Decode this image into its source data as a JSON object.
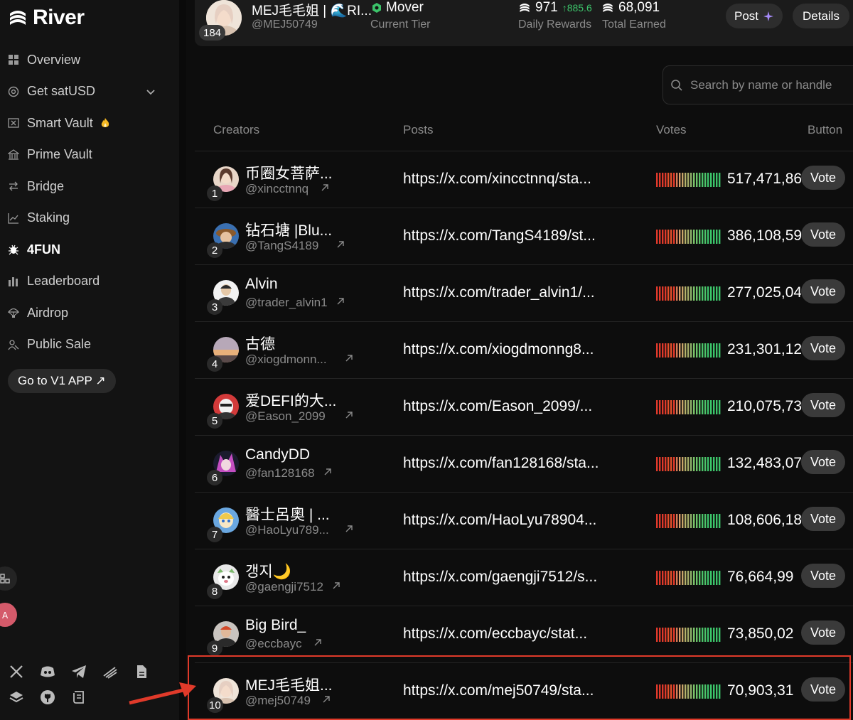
{
  "brand": {
    "name": "River"
  },
  "nav": [
    {
      "label": "Overview",
      "icon": "grid-icon"
    },
    {
      "label": "Get satUSD",
      "icon": "target-icon",
      "chevron": true
    },
    {
      "label": "Smart Vault",
      "icon": "vault-icon",
      "fire": true
    },
    {
      "label": "Prime Vault",
      "icon": "bank-icon"
    },
    {
      "label": "Bridge",
      "icon": "bridge-icon"
    },
    {
      "label": "Staking",
      "icon": "chart-icon"
    },
    {
      "label": "4FUN",
      "icon": "bug-icon",
      "active": true
    },
    {
      "label": "Leaderboard",
      "icon": "bars-icon"
    },
    {
      "label": "Airdrop",
      "icon": "parachute-icon"
    },
    {
      "label": "Public Sale",
      "icon": "people-icon"
    }
  ],
  "v1_button": "Go to V1 APP ↗",
  "user": {
    "name": "MEJ毛毛姐 | 🌊RI...",
    "handle": "@MEJ50749",
    "rank": "184",
    "tier": "Mover",
    "tier_label": "Current Tier",
    "daily": "971",
    "daily_delta": "↑885.6",
    "daily_label": "Daily Rewards",
    "total": "68,091",
    "total_label": "Total Earned",
    "post_button": "Post",
    "details_button": "Details"
  },
  "search": {
    "placeholder": "Search by name or handle"
  },
  "table": {
    "headers": {
      "creators": "Creators",
      "posts": "Posts",
      "votes": "Votes",
      "button": "Button"
    },
    "vote_label": "Vote",
    "rows": [
      {
        "rank": "1",
        "name": "币圈女菩萨...",
        "handle": "@xincctnnq",
        "post": "https://x.com/xincctnnq/sta...",
        "votes": "517,471,86"
      },
      {
        "rank": "2",
        "name": "钻石塘 |Blu...",
        "handle": "@TangS4189",
        "post": "https://x.com/TangS4189/st...",
        "votes": "386,108,59"
      },
      {
        "rank": "3",
        "name": "Alvin",
        "handle": "@trader_alvin1",
        "post": "https://x.com/trader_alvin1/...",
        "votes": "277,025,04"
      },
      {
        "rank": "4",
        "name": "古德",
        "handle": "@xiogdmonn...",
        "post": "https://x.com/xiogdmonng8...",
        "votes": "231,301,12"
      },
      {
        "rank": "5",
        "name": "爱DEFI的大...",
        "handle": "@Eason_2099",
        "post": "https://x.com/Eason_2099/...",
        "votes": "210,075,73"
      },
      {
        "rank": "6",
        "name": "CandyDD",
        "handle": "@fan128168",
        "post": "https://x.com/fan128168/sta...",
        "votes": "132,483,07"
      },
      {
        "rank": "7",
        "name": "醫士呂奧 | ...",
        "handle": "@HaoLyu789...",
        "post": "https://x.com/HaoLyu78904...",
        "votes": "108,606,18"
      },
      {
        "rank": "8",
        "name": "갱지🌙",
        "handle": "@gaengji7512",
        "post": "https://x.com/gaengji7512/s...",
        "votes": "76,664,99"
      },
      {
        "rank": "9",
        "name": "Big Bird_",
        "handle": "@eccbayc",
        "post": "https://x.com/eccbayc/stat...",
        "votes": "73,850,02"
      },
      {
        "rank": "10",
        "name": "MEJ毛毛姐...",
        "handle": "@mej50749",
        "post": "https://x.com/mej50749/sta...",
        "votes": "70,903,31"
      }
    ]
  },
  "colors": {
    "highlight": "#e03a2a",
    "accent_green": "#3cc46a"
  }
}
